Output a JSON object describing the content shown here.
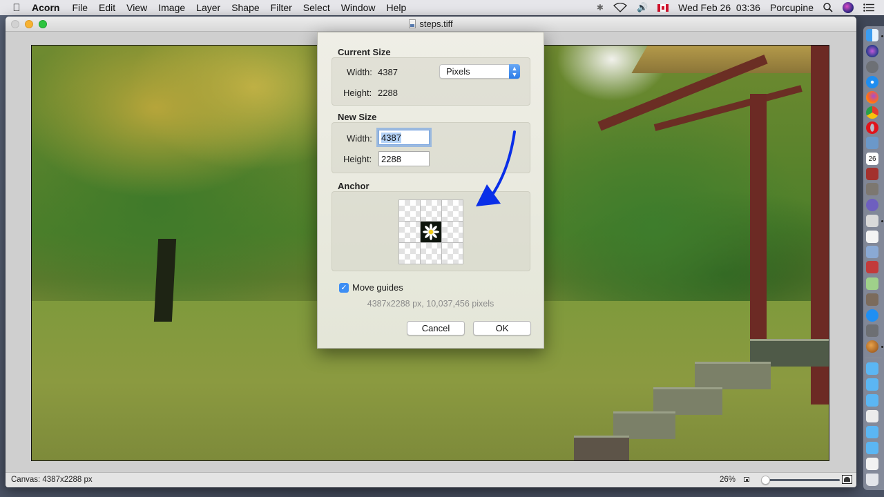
{
  "menubar": {
    "app_name": "Acorn",
    "items": [
      "File",
      "Edit",
      "View",
      "Image",
      "Layer",
      "Shape",
      "Filter",
      "Select",
      "Window",
      "Help"
    ],
    "status": {
      "datetime": "Wed Feb 26  03:36",
      "user": "Porcupine"
    }
  },
  "window": {
    "title": "steps.tiff",
    "statusbar": {
      "canvas_info": "Canvas: 4387x2288 px",
      "zoom_percent": "26%",
      "zoom_slider_value": 0.0
    }
  },
  "dialog": {
    "current_size": {
      "title": "Current Size",
      "width_label": "Width:",
      "width_value": "4387",
      "height_label": "Height:",
      "height_value": "2288",
      "unit_selected": "Pixels"
    },
    "new_size": {
      "title": "New Size",
      "width_label": "Width:",
      "width_value": "4387",
      "height_label": "Height:",
      "height_value": "2288"
    },
    "anchor": {
      "title": "Anchor",
      "selected_cell": "center"
    },
    "move_guides": {
      "label": "Move guides",
      "checked": true
    },
    "pixel_info": "4387x2288 px, 10,037,456 pixels",
    "cancel_label": "Cancel",
    "ok_label": "OK",
    "annotation_arrow_color": "#0a2fe8"
  },
  "dock": {
    "apps": [
      "Finder",
      "Siri",
      "Launchpad",
      "Safari",
      "Firefox",
      "Chrome",
      "Opera",
      "Preview",
      "Calendar",
      "Dictionary",
      "Calculator",
      "BBEdit",
      "Grapher",
      "TextEdit",
      "Image Capture",
      "Photo Booth",
      "Maps",
      "Photos",
      "App Store",
      "System Preferences",
      "Acorn"
    ],
    "calendar_day": "26",
    "folders": [
      "Folder",
      "Folder",
      "Folder",
      "Document",
      "Folder",
      "Folder",
      "Screenshot",
      "Trash"
    ]
  }
}
